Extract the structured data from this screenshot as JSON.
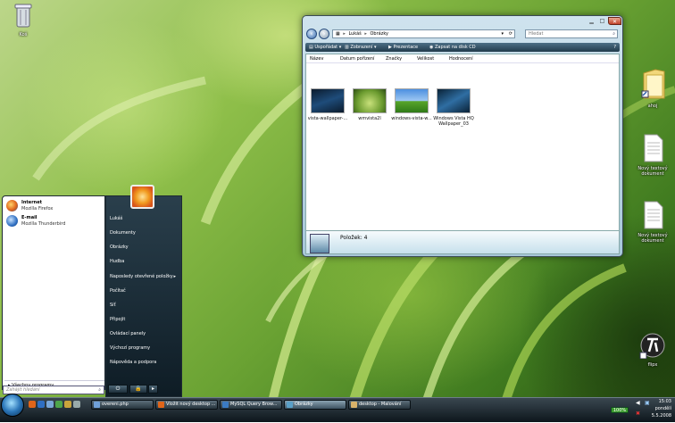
{
  "desktop": {
    "recycle_bin": "Koš",
    "icons": [
      {
        "label": "ahoj"
      },
      {
        "label": "Nový textový dokument"
      },
      {
        "label": "Nový textový dokument"
      },
      {
        "label": "flipx"
      }
    ]
  },
  "explorer": {
    "address": {
      "root": "Lukáš",
      "folder": "Obrázky"
    },
    "search_placeholder": "Hledat",
    "toolbar": {
      "organize": "Uspořádat",
      "views": "Zobrazení",
      "slideshow": "Prezentace",
      "burn": "Zapsat na disk CD"
    },
    "columns": [
      "Název",
      "Datum pořízení",
      "Značky",
      "Velikost",
      "Hodnocení"
    ],
    "items": [
      {
        "label": "vista-wallpaper-..."
      },
      {
        "label": "wmvista2l"
      },
      {
        "label": "windows-vista-w..."
      },
      {
        "label": "Windows Vista HQ Wallpaper_03"
      }
    ],
    "status": "Položek: 4"
  },
  "start_menu": {
    "pinned": [
      {
        "title": "Internet",
        "subtitle": "Mozilla Firefox"
      },
      {
        "title": "E-mail",
        "subtitle": "Mozilla Thunderbird"
      }
    ],
    "all_programs": "Všechny programy",
    "search_placeholder": "Zahájit hledání",
    "right_links": [
      "Lukáš",
      "Dokumenty",
      "Obrázky",
      "Hudba",
      "Naposledy otevřené položky",
      "Počítač",
      "Síť",
      "Připojit",
      "Ovládací panely",
      "Výchozí programy",
      "Nápověda a podpora"
    ],
    "power_icon": "⏻",
    "lock_icon": "🔒"
  },
  "taskbar": {
    "buttons": [
      "overeni.php",
      "Vložit nový desktop ...",
      "MySQL Query Brow...",
      "Obrázky",
      "desktop - Malování"
    ],
    "zoom": "100%",
    "clock": {
      "time": "15:03",
      "day": "pondělí",
      "date": "5.5.2008"
    }
  },
  "colors": {
    "accent": "#2b76b9",
    "taskbar": "#1b262d"
  }
}
